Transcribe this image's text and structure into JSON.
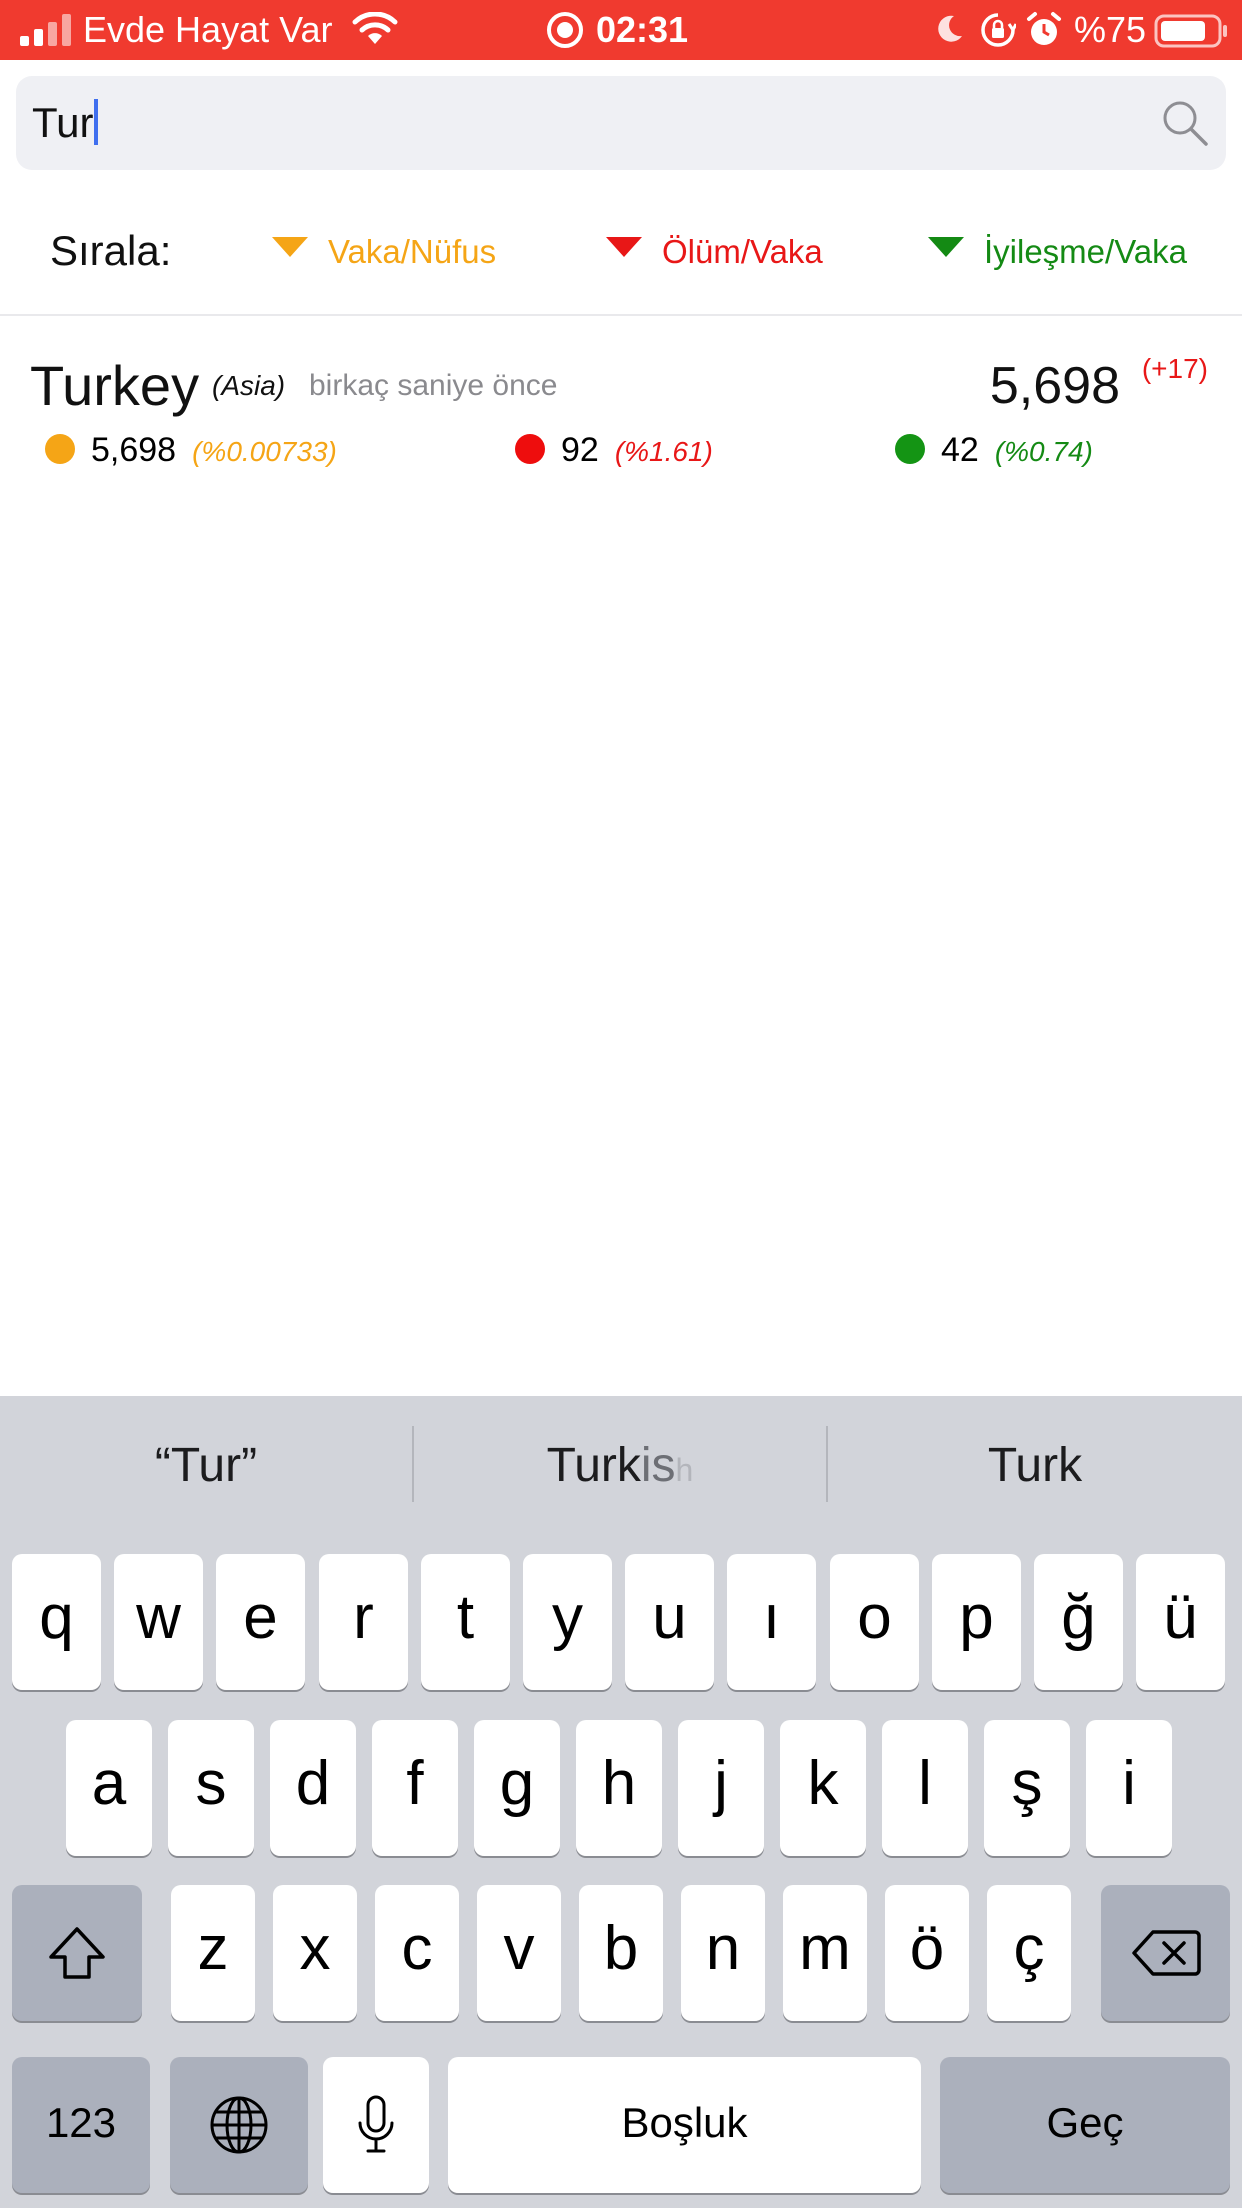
{
  "status_bar": {
    "carrier": "Evde Hayat Var",
    "time": "02:31",
    "battery": "%75",
    "icons": [
      "signal-icon",
      "wifi-icon",
      "screen-record-icon",
      "moon-icon",
      "rotation-lock-icon",
      "alarm-icon",
      "battery-icon"
    ],
    "background_color": "#f03a2f"
  },
  "search": {
    "value": "Tur",
    "icon": "search-icon"
  },
  "sort": {
    "label": "Sırala:",
    "options": [
      {
        "label": "Vaka/Nüfus",
        "color": "#f5a516"
      },
      {
        "label": "Ölüm/Vaka",
        "color": "#e81717"
      },
      {
        "label": "İyileşme/Vaka",
        "color": "#148a14"
      }
    ]
  },
  "results": [
    {
      "country": "Turkey",
      "continent": "(Asia)",
      "updated": "birkaç saniye önce",
      "total": "5,698",
      "delta": "(+17)",
      "cases": {
        "value": "5,698",
        "pct": "(%0.00733)"
      },
      "deaths": {
        "value": "92",
        "pct": "(%1.61)"
      },
      "recovered": {
        "value": "42",
        "pct": "(%0.74)"
      }
    }
  ],
  "keyboard": {
    "suggestions": [
      "“Tur”",
      "Turkish",
      "Turk"
    ],
    "row1": [
      "q",
      "w",
      "e",
      "r",
      "t",
      "y",
      "u",
      "ı",
      "o",
      "p",
      "ğ",
      "ü"
    ],
    "row2": [
      "a",
      "s",
      "d",
      "f",
      "g",
      "h",
      "j",
      "k",
      "l",
      "ş",
      "i"
    ],
    "row3": [
      "z",
      "x",
      "c",
      "v",
      "b",
      "n",
      "m",
      "ö",
      "ç"
    ],
    "numbers_label": "123",
    "space_label": "Boşluk",
    "return_label": "Geç"
  }
}
